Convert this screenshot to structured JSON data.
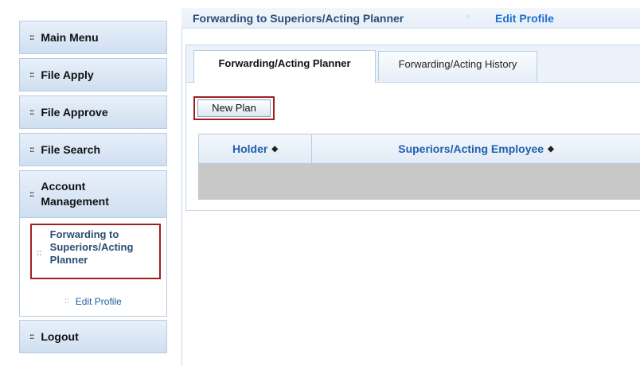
{
  "sidebar": {
    "main_menu": "Main Menu",
    "file_apply": "File Apply",
    "file_approve": "File Approve",
    "file_search": "File Search",
    "account_management": "Account Management",
    "account_submenu": {
      "forwarding": "Forwarding to Superiors/Acting Planner",
      "edit_profile": "Edit Profile"
    },
    "logout": "Logout",
    "bullet": "::"
  },
  "topbar": {
    "title": "Forwarding to Superiors/Acting Planner",
    "edit_profile": "Edit Profile"
  },
  "tabs": {
    "planner": "Forwarding/Acting Planner",
    "history": "Forwarding/Acting History"
  },
  "actions": {
    "new_plan": "New Plan"
  },
  "grid": {
    "columns": [
      "Holder",
      "Superiors/Acting Employee"
    ],
    "sort_glyph": "◆"
  },
  "colors": {
    "accent": "#1f5fb0",
    "highlight_border": "#a02020",
    "sidebar_bg": "#cfdff1"
  }
}
